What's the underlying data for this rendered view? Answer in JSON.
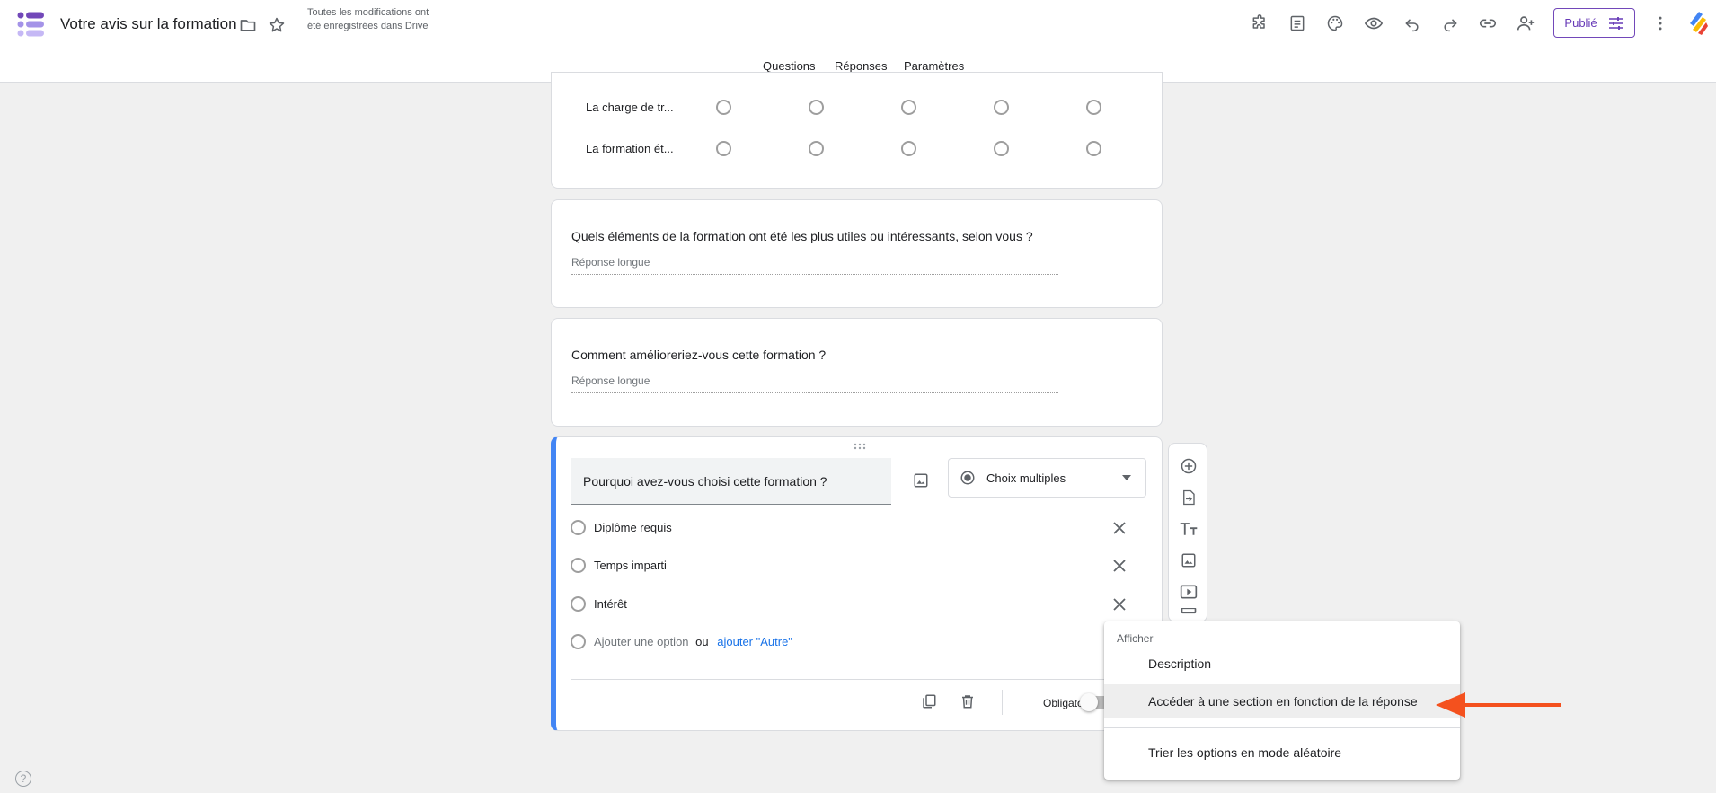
{
  "app": {
    "title": "Votre avis sur la formation",
    "save_status": "Toutes les modifications ont été enregistrées dans Drive",
    "publish_label": "Publié"
  },
  "tabs": [
    {
      "label": "Questions",
      "active": true
    },
    {
      "label": "Réponses",
      "active": false
    },
    {
      "label": "Paramètres",
      "active": false
    }
  ],
  "grid_question": {
    "rows": [
      "La charge de tr...",
      "La formation ét..."
    ]
  },
  "questions": [
    {
      "title": "Quels éléments de la formation ont été les plus utiles ou intéressants, selon vous ?",
      "answer_placeholder": "Réponse longue"
    },
    {
      "title": "Comment amélioreriez-vous cette formation ?",
      "answer_placeholder": "Réponse longue"
    }
  ],
  "active_question": {
    "title": "Pourquoi avez-vous choisi cette formation ?",
    "type": "Choix multiples",
    "options": [
      "Diplôme requis",
      "Temps imparti",
      "Intérêt"
    ],
    "add_option": "Ajouter une option",
    "or": "ou",
    "add_other": "ajouter \"Autre\"",
    "required_label": "Obligatoire",
    "required": false
  },
  "menu": {
    "header": "Afficher",
    "items": [
      {
        "label": "Description",
        "highlighted": false
      },
      {
        "label": "Accéder à une section en fonction de la réponse",
        "highlighted": true
      },
      {
        "label": "Trier les options en mode aléatoire",
        "highlighted": false
      }
    ]
  },
  "colors": {
    "accent": "#673ab7",
    "active_border": "#4285f4",
    "link": "#1a73e8",
    "annotation_arrow": "#f4511e"
  },
  "help_glyph": "?"
}
